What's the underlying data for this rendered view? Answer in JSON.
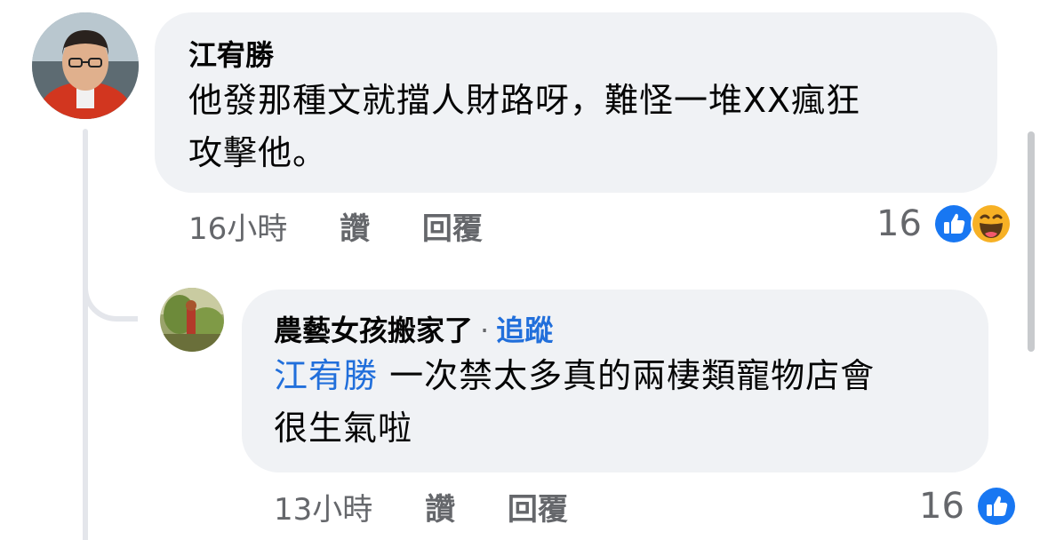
{
  "comments": [
    {
      "author": "江宥勝",
      "text_lines": [
        "他發那種文就擋人財路呀，難怪一堆XX瘋狂",
        "攻擊他。"
      ],
      "time": "16小時",
      "like_label": "讚",
      "reply_label": "回覆",
      "reaction_count": "16",
      "reactions": [
        "like-icon",
        "haha-icon"
      ]
    },
    {
      "author": "農藝女孩搬家了",
      "separator": "·",
      "follow_label": "追蹤",
      "mention": "江宥勝",
      "text_line1": "一次禁太多真的兩棲類寵物店會",
      "text_line2": "很生氣啦",
      "time": "13小時",
      "like_label": "讚",
      "reply_label": "回覆",
      "reaction_count": "16",
      "reactions": [
        "like-icon"
      ]
    }
  ],
  "colors": {
    "bubble": "#f0f2f5",
    "link_blue": "#216fdb",
    "meta_gray": "#65676b",
    "like_blue": "#1877f2",
    "haha_yellow": "#f7b125"
  }
}
